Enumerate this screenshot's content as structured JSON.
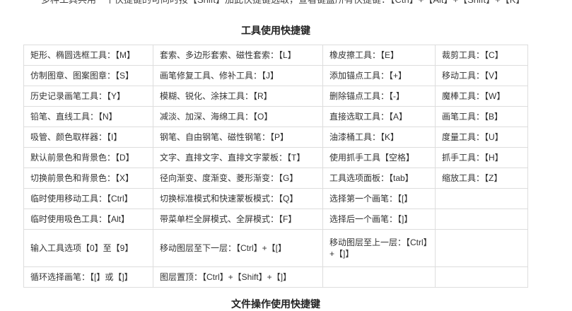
{
  "intro_text": "多种工具共用一个快捷键的可同时按【Shift】加此快捷键选取，查看键盘所有快捷键：【Ctrl】+【Alt】+【Shift】+【K】",
  "section_title": "工具使用快捷键",
  "next_section_title": "文件操作使用快捷键",
  "table": {
    "rows": [
      [
        "矩形、椭圆选框工具：【M】",
        "套索、多边形套索、磁性套索：【L】",
        "橡皮擦工具：【E】",
        "裁剪工具：【C】"
      ],
      [
        "仿制图章、图案图章：【S】",
        "画笔修复工具、修补工具：【J】",
        "添加锚点工具：【+】",
        "移动工具：【V】"
      ],
      [
        "历史记录画笔工具：【Y】",
        "模糊、锐化、涂抹工具：【R】",
        "删除锚点工具：【-】",
        "魔棒工具：【W】"
      ],
      [
        "铅笔、直线工具：【N】",
        "减淡、加深、海绵工具：【O】",
        "直接选取工具：【A】",
        "画笔工具：【B】"
      ],
      [
        "吸管、颜色取样器：【I】",
        "钢笔、自由钢笔、磁性钢笔：【P】",
        "油漆桶工具：【K】",
        "度量工具：【U】"
      ],
      [
        "默认前景色和背景色：【D】",
        "文字、直排文字、直排文字蒙板：【T】",
        "使用抓手工具【空格】",
        "抓手工具：【H】"
      ],
      [
        "切换前景色和背景色：【X】",
        "径向渐变、度渐变、菱形渐变：【G】",
        "工具选项面板：【tab】",
        "缩放工具：【Z】"
      ],
      [
        "临时使用移动工具：【Ctrl】",
        "切换标准模式和快速蒙板模式：【Q】",
        "选择第一个画笔：【[】",
        ""
      ],
      [
        "临时使用吸色工具：【Alt】",
        "带菜单栏全屏模式、全屏模式：【F】",
        "选择后一个画笔：【]】",
        ""
      ],
      [
        "输入工具选项【0】至【9】",
        "移动图层至下一层：【Ctrl】+【[】",
        "移动图层至上一层：【Ctrl】+【]】",
        ""
      ],
      [
        "循环选择画笔：【[】或【]】",
        "图层置顶：【Ctrl】+【Shift】+【]】",
        "",
        ""
      ]
    ]
  }
}
